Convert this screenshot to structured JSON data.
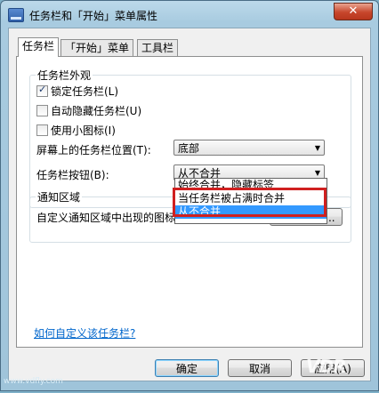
{
  "window": {
    "title": "任务栏和「开始」菜单属性",
    "close_glyph": "✕"
  },
  "tabs": [
    {
      "label": "任务栏"
    },
    {
      "label": "「开始」菜单"
    },
    {
      "label": "工具栏"
    }
  ],
  "appearance": {
    "group_label": "任务栏外观",
    "lock_taskbar": {
      "label": "锁定任务栏(L)",
      "checked": true
    },
    "auto_hide": {
      "label": "自动隐藏任务栏(U)",
      "checked": false
    },
    "small_icons": {
      "label": "使用小图标(I)",
      "checked": false
    },
    "location_label": "屏幕上的任务栏位置(T):",
    "location_value": "底部",
    "buttons_label": "任务栏按钮(B):",
    "buttons_value": "从不合并",
    "buttons_options": [
      "始终合并，隐藏标签",
      "当任务栏被占满时合并",
      "从不合并"
    ]
  },
  "notification": {
    "group_label": "通知区域",
    "description": "自定义通知区域中出现的图标和通知。",
    "customize_button": "自定义(C)..."
  },
  "help_link": "如何自定义该任务栏?",
  "footer": {
    "ok": "确定",
    "cancel": "取消",
    "apply": "应用(A)"
  },
  "watermark": "www.vdfly.com"
}
